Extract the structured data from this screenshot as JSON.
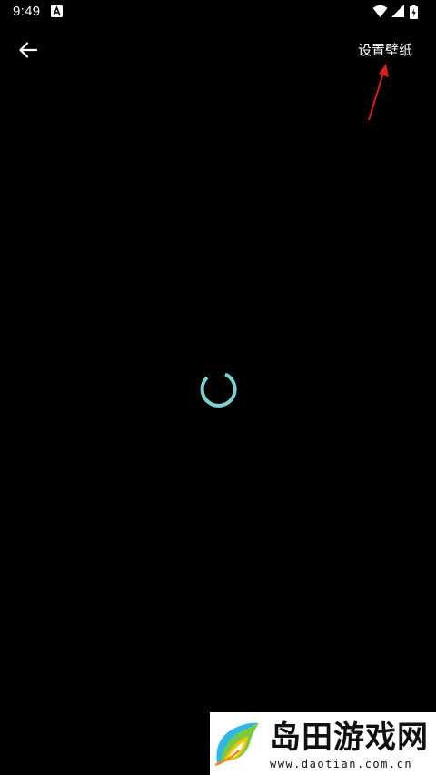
{
  "status_bar": {
    "time": "9:49",
    "notification_icon": "a-letter-icon",
    "wifi_icon": "wifi-icon",
    "signal_icon": "cell-signal-icon",
    "battery_icon": "battery-icon"
  },
  "toolbar": {
    "back_icon": "arrow-left-icon",
    "set_wallpaper_label": "设置壁纸"
  },
  "annotation": {
    "arrow_color": "#d81f1f"
  },
  "content": {
    "loading_indicator": "spinner",
    "spinner_color": "#7ecfcf",
    "background_color": "#000000"
  },
  "watermark": {
    "title": "岛田游戏网",
    "url": "www.daotian.com.cn",
    "logo_icon": "daotian-leaf-logo-icon"
  }
}
